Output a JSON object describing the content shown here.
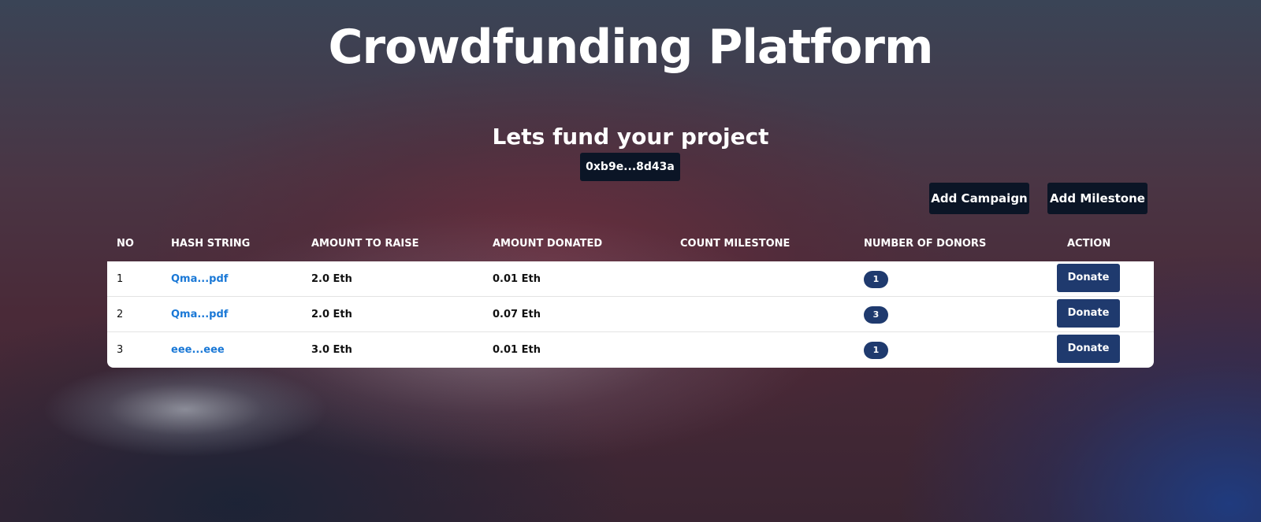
{
  "header": {
    "title": "Crowdfunding Platform",
    "subtitle": "Lets fund your project",
    "account": "0xb9e...8d43a"
  },
  "actions": {
    "add_campaign": "Add Campaign",
    "add_milestone": "Add Milestone"
  },
  "table": {
    "columns": [
      "NO",
      "HASH STRING",
      "AMOUNT TO RAISE",
      "AMOUNT DONATED",
      "COUNT MILESTONE",
      "NUMBER OF DONORS",
      "ACTION"
    ],
    "rows": [
      {
        "no": "1",
        "hash": "Qma...pdf",
        "raise": "2.0 Eth",
        "donated": "0.01 Eth",
        "milestone": "",
        "donors": "1",
        "action": "Donate"
      },
      {
        "no": "2",
        "hash": "Qma...pdf",
        "raise": "2.0 Eth",
        "donated": "0.07 Eth",
        "milestone": "",
        "donors": "3",
        "action": "Donate"
      },
      {
        "no": "3",
        "hash": "eee...eee",
        "raise": "3.0 Eth",
        "donated": "0.01 Eth",
        "milestone": "",
        "donors": "1",
        "action": "Donate"
      }
    ]
  },
  "colors": {
    "dark_button": "#0b1526",
    "primary_button": "#1f3a6e",
    "link": "#1a78d6"
  }
}
